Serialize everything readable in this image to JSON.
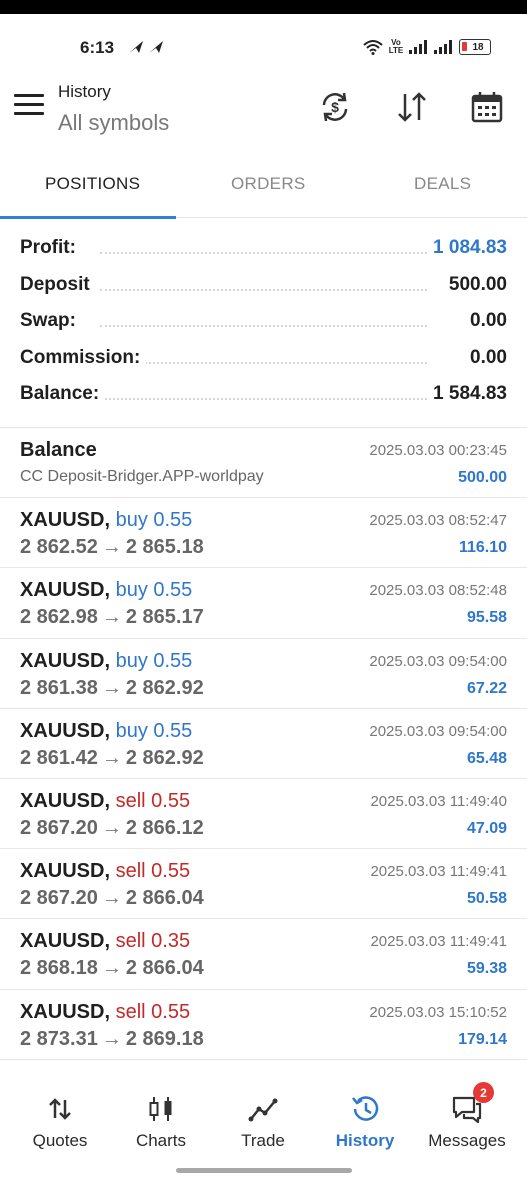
{
  "status": {
    "time": "6:13",
    "volte": [
      "Vo",
      "LTE"
    ],
    "battery": "18"
  },
  "header": {
    "title": "History",
    "subtitle": "All symbols",
    "icons": [
      "refresh-dollar-icon",
      "sort-icon",
      "calendar-icon"
    ]
  },
  "tabs": [
    {
      "label": "POSITIONS",
      "active": true
    },
    {
      "label": "ORDERS",
      "active": false
    },
    {
      "label": "DEALS",
      "active": false
    }
  ],
  "summary": [
    {
      "label": "Profit:",
      "value": "1 084.83"
    },
    {
      "label": "Deposit",
      "value": "500.00"
    },
    {
      "label": "Swap:",
      "value": "0.00"
    },
    {
      "label": "Commission:",
      "value": "0.00"
    },
    {
      "label": "Balance:",
      "value": "1 584.83"
    }
  ],
  "balance_entry": {
    "title": "Balance",
    "description": "CC Deposit-Bridger.APP-worldpay",
    "time": "2025.03.03 00:23:45",
    "amount": "500.00"
  },
  "positions": [
    {
      "symbol": "XAUUSD,",
      "direction": "buy 0.55",
      "type": "buy",
      "open": "2 862.52",
      "close": "2 865.18",
      "time": "2025.03.03 08:52:47",
      "profit": "116.10"
    },
    {
      "symbol": "XAUUSD,",
      "direction": "buy 0.55",
      "type": "buy",
      "open": "2 862.98",
      "close": "2 865.17",
      "time": "2025.03.03 08:52:48",
      "profit": "95.58"
    },
    {
      "symbol": "XAUUSD,",
      "direction": "buy 0.55",
      "type": "buy",
      "open": "2 861.38",
      "close": "2 862.92",
      "time": "2025.03.03 09:54:00",
      "profit": "67.22"
    },
    {
      "symbol": "XAUUSD,",
      "direction": "buy 0.55",
      "type": "buy",
      "open": "2 861.42",
      "close": "2 862.92",
      "time": "2025.03.03 09:54:00",
      "profit": "65.48"
    },
    {
      "symbol": "XAUUSD,",
      "direction": "sell 0.55",
      "type": "sell",
      "open": "2 867.20",
      "close": "2 866.12",
      "time": "2025.03.03 11:49:40",
      "profit": "47.09"
    },
    {
      "symbol": "XAUUSD,",
      "direction": "sell 0.55",
      "type": "sell",
      "open": "2 867.20",
      "close": "2 866.04",
      "time": "2025.03.03 11:49:41",
      "profit": "50.58"
    },
    {
      "symbol": "XAUUSD,",
      "direction": "sell 0.35",
      "type": "sell",
      "open": "2 868.18",
      "close": "2 866.04",
      "time": "2025.03.03 11:49:41",
      "profit": "59.38"
    },
    {
      "symbol": "XAUUSD,",
      "direction": "sell 0.55",
      "type": "sell",
      "open": "2 873.31",
      "close": "2 869.18",
      "time": "2025.03.03 15:10:52",
      "profit": "179.14"
    }
  ],
  "arrow": "→",
  "nav": [
    {
      "label": "Quotes",
      "icon": "quotes-icon",
      "active": false
    },
    {
      "label": "Charts",
      "icon": "charts-icon",
      "active": false
    },
    {
      "label": "Trade",
      "icon": "trade-icon",
      "active": false
    },
    {
      "label": "History",
      "icon": "history-icon",
      "active": true
    },
    {
      "label": "Messages",
      "icon": "messages-icon",
      "active": false,
      "badge": "2"
    }
  ],
  "colors": {
    "accent": "#2f77cc",
    "buy": "#2f77cc",
    "sell": "#c62828",
    "badge": "#e53935"
  }
}
